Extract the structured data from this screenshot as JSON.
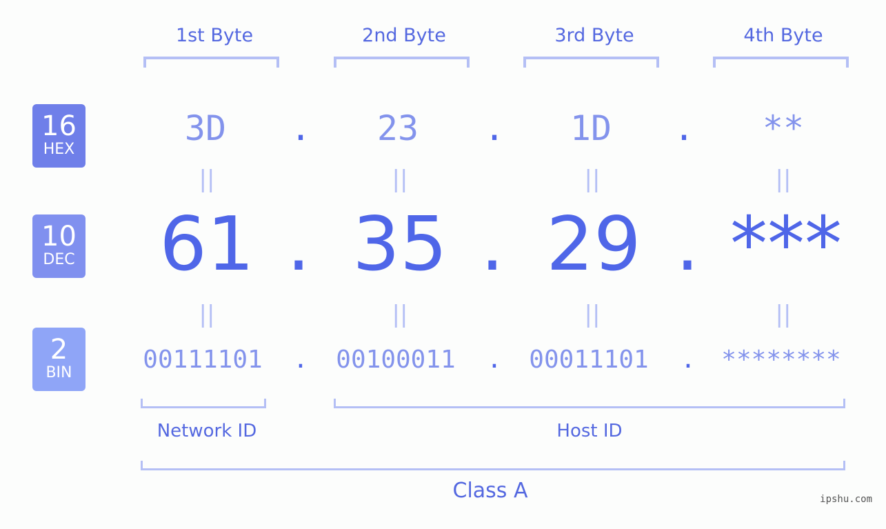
{
  "bytes": [
    "1st Byte",
    "2nd Byte",
    "3rd Byte",
    "4th Byte"
  ],
  "badges": [
    {
      "num": "16",
      "label": "HEX",
      "color": "#6f7fe9"
    },
    {
      "num": "10",
      "label": "DEC",
      "color": "#8090ef"
    },
    {
      "num": "2",
      "label": "BIN",
      "color": "#8fa5f7"
    }
  ],
  "hex": [
    "3D",
    "23",
    "1D",
    "**"
  ],
  "dec": [
    "61",
    "35",
    "29",
    "***"
  ],
  "bin": [
    "00111101",
    "00100011",
    "00011101",
    "********"
  ],
  "separator": ".",
  "equals": "||",
  "network_id": "Network ID",
  "host_id": "Host ID",
  "class_label": "Class A",
  "watermark": "ipshu.com",
  "colors": {
    "accent": "#4f66e8",
    "bracket": "#b4bff5",
    "light": "#8393ec"
  }
}
